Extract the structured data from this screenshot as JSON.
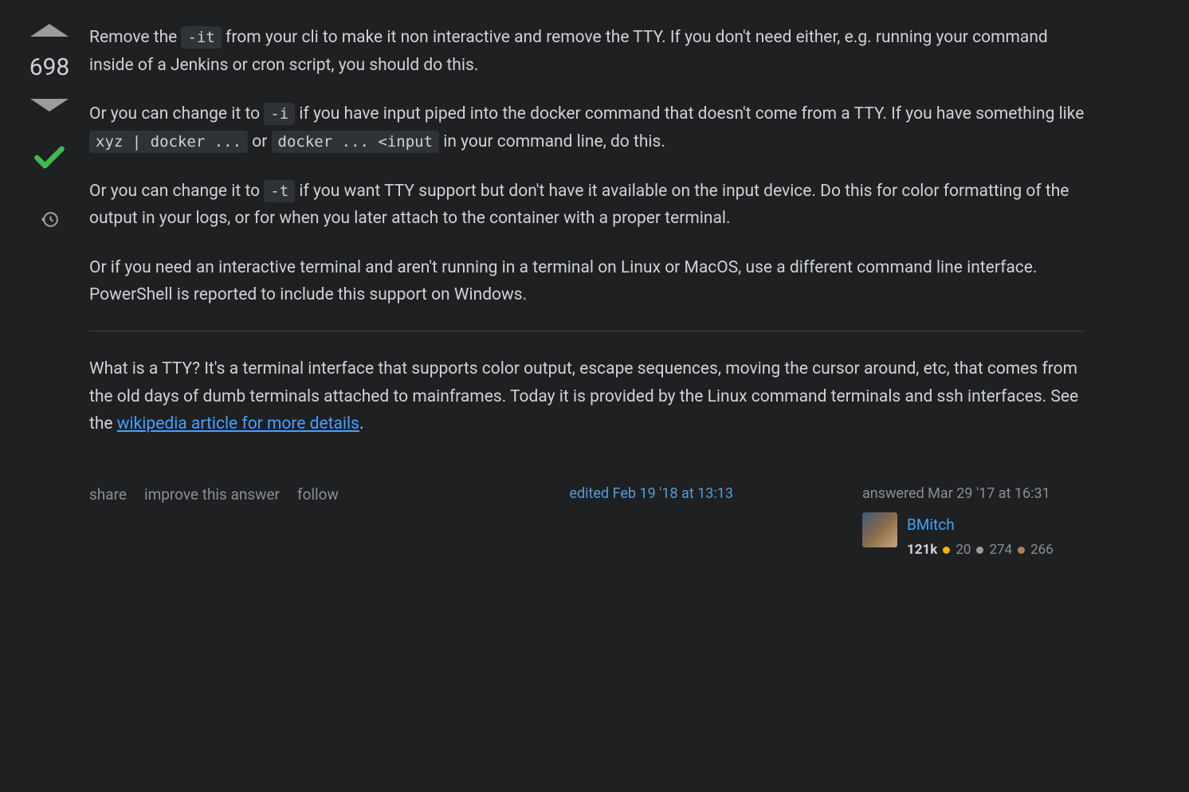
{
  "vote": {
    "score": "698"
  },
  "answer": {
    "p1_a": "Remove the ",
    "code_it": "-it",
    "p1_b": " from your cli to make it non interactive and remove the TTY. If you don't need either, e.g. running your command inside of a Jenkins or cron script, you should do this.",
    "p2_a": "Or you can change it to ",
    "code_i": "-i",
    "p2_b": " if you have input piped into the docker command that doesn't come from a TTY. If you have something like ",
    "code_xyz": "xyz | docker ...",
    "p2_c": " or ",
    "code_input": "docker ... <input",
    "p2_d": " in your command line, do this.",
    "p3_a": "Or you can change it to ",
    "code_t": "-t",
    "p3_b": " if you want TTY support but don't have it available on the input device. Do this for color formatting of the output in your logs, or for when you later attach to the container with a proper terminal.",
    "p4": "Or if you need an interactive terminal and aren't running in a terminal on Linux or MacOS, use a different command line interface. PowerShell is reported to include this support on Windows.",
    "p5_a": "What is a TTY? It's a terminal interface that supports color output, escape sequences, moving the cursor around, etc, that comes from the old days of dumb terminals attached to mainframes. Today it is provided by the Linux command terminals and ssh interfaces. See the ",
    "link_text": "wikipedia article for more details",
    "p5_b": "."
  },
  "actions": {
    "share": "share",
    "improve": "improve this answer",
    "follow": "follow"
  },
  "edit": {
    "text": "edited Feb 19 '18 at 13:13"
  },
  "user": {
    "answered": "answered Mar 29 '17 at 16:31",
    "name": "BMitch",
    "rep": "121k",
    "gold": "20",
    "silver": "274",
    "bronze": "266"
  }
}
